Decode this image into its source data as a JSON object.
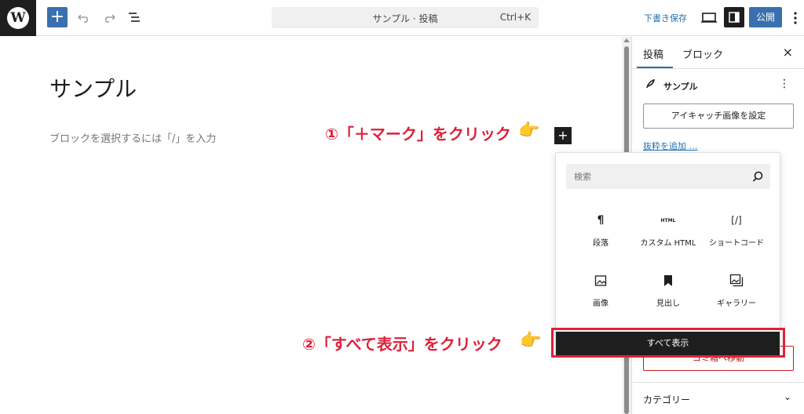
{
  "toolbar": {
    "logo_glyph": "W",
    "add_block_label": "+",
    "document_title": "サンプル · 投稿",
    "command_shortcut": "Ctrl+K",
    "save_draft_label": "下書き保存",
    "publish_label": "公開",
    "icons": {
      "undo": "undo-icon",
      "redo": "redo-icon",
      "list_view": "list-view-icon",
      "preview": "desktop-preview-icon",
      "settings": "settings-sidebar-icon",
      "options": "more-vertical-icon"
    },
    "accent_color": "#3870b0"
  },
  "editor": {
    "post_title": "サンプル",
    "block_placeholder": "ブロックを選択するには「/」を入力",
    "inline_inserter_label": "+"
  },
  "sidebar": {
    "tabs": [
      {
        "label": "投稿",
        "active": true
      },
      {
        "label": "ブロック",
        "active": false
      }
    ],
    "close_label": "×",
    "post_summary_title": "サンプル",
    "post_summary_more": "⋮",
    "featured_image_label": "アイキャッチ画像を設定",
    "excerpt_link": "抜粋を追加 …",
    "trash_label": "ゴミ箱へ移動",
    "category_label": "カテゴリー",
    "category_chevron": "⌄"
  },
  "inserter": {
    "search_placeholder": "検索",
    "blocks": [
      {
        "icon": "paragraph-icon",
        "glyph": "¶",
        "label": "段落"
      },
      {
        "icon": "html-icon",
        "glyph": "HTML",
        "label": "カスタム HTML"
      },
      {
        "icon": "shortcode-icon",
        "glyph": "[/]",
        "label": "ショートコード"
      },
      {
        "icon": "image-icon",
        "glyph": "",
        "label": "画像"
      },
      {
        "icon": "heading-icon",
        "glyph": "",
        "label": "見出し"
      },
      {
        "icon": "gallery-icon",
        "glyph": "",
        "label": "ギャラリー"
      }
    ],
    "show_all_label": "すべて表示"
  },
  "annotations": {
    "step1": "①「＋マーク」をクリック",
    "step2": "②「すべて表示」をクリック",
    "hand": "👉",
    "color": "#e0203a"
  }
}
